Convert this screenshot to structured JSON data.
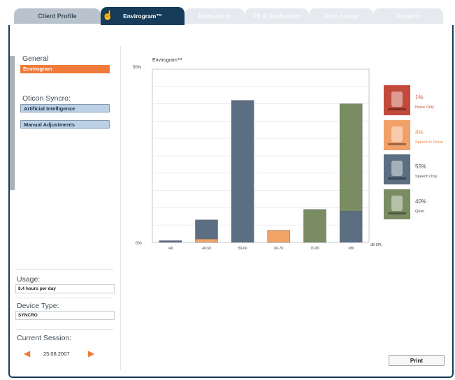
{
  "tabs": [
    {
      "label": "Client Profile"
    },
    {
      "label": "Envirogram™"
    },
    {
      "label": "Evaluation"
    },
    {
      "label": "Fit & Evaluation"
    },
    {
      "label": "Auto Assist"
    },
    {
      "label": "Support"
    }
  ],
  "sidebar": {
    "general_label": "General",
    "envirogram_item": "Envirogram",
    "syncro_label": "Oticon Syncro:",
    "ai_item": "Artificial Intelligence",
    "manual_item": "Manual Adjustments"
  },
  "usage": {
    "label": "Usage:",
    "value": "8.4 hours per day"
  },
  "device": {
    "label": "Device Type:",
    "value": "SYNCRO"
  },
  "session": {
    "label": "Current Session:",
    "date": "25.08.2007"
  },
  "print_label": "Print",
  "chart_data": {
    "type": "bar",
    "title": "Envirogram™",
    "y_top_label": "50%",
    "y_bottom_label": "0%",
    "x_unit": "dB SPL",
    "categories": [
      "<40",
      "40-50",
      "50-60",
      "60-70",
      "70-80",
      ">80"
    ],
    "ylim": [
      0,
      50
    ],
    "series": [
      {
        "name": "Noise Only",
        "values": [
          0,
          0,
          0,
          0,
          0,
          0
        ]
      },
      {
        "name": "Speech in Noise",
        "values": [
          0,
          1,
          0,
          3.5,
          0,
          0
        ]
      },
      {
        "name": "Speech Only",
        "values": [
          0.5,
          5.5,
          41,
          0,
          0,
          9
        ]
      },
      {
        "name": "Quiet",
        "values": [
          0,
          0,
          0,
          0,
          9.5,
          31
        ]
      }
    ],
    "colors": {
      "Noise Only": "#c2493a",
      "Speech in Noise": "#f2a468",
      "Speech Only": "#5b6e82",
      "Quiet": "#7a8c62"
    }
  },
  "legend": [
    {
      "pct": "1%",
      "name": "Noise Only",
      "color": "#d2503c",
      "tile": "#c24a3b",
      "icon": "noise-icon"
    },
    {
      "pct": "4%",
      "name": "Speech in Noise",
      "color": "#f08a48",
      "tile": "#f2a06a",
      "icon": "speech-in-noise-icon"
    },
    {
      "pct": "55%",
      "name": "Speech Only",
      "color": "#4a5563",
      "tile": "#5b6e82",
      "icon": "speech-icon"
    },
    {
      "pct": "40%",
      "name": "Quiet",
      "color": "#4a5563",
      "tile": "#7a8c62",
      "icon": "quiet-icon"
    }
  ]
}
